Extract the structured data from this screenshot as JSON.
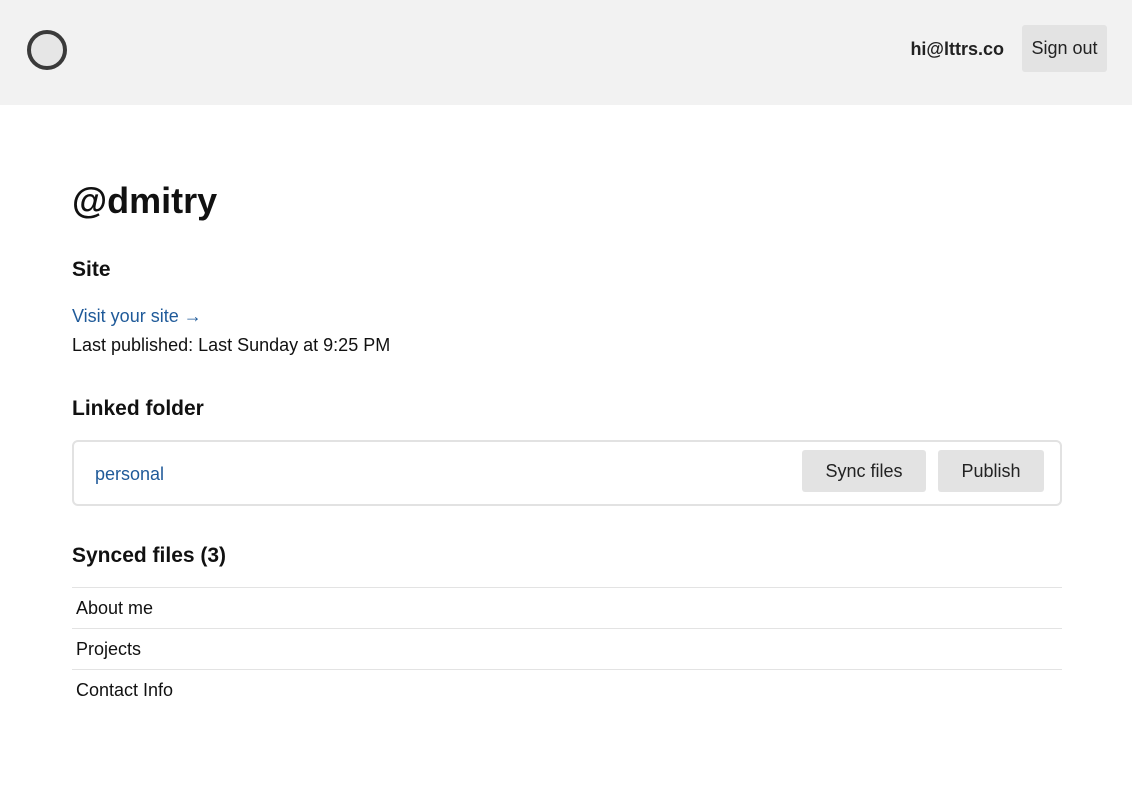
{
  "header": {
    "logo_icon": "circle-logo-icon",
    "email": "hi@lttrs.co",
    "signout_label": "Sign out"
  },
  "profile": {
    "handle": "@dmitry"
  },
  "site": {
    "heading": "Site",
    "visit_link": "Visit your site →",
    "last_published": "Last published: Last Sunday at 9:25 PM"
  },
  "linked_folder": {
    "heading": "Linked folder",
    "folder_name": "personal",
    "sync_label": "Sync files",
    "publish_label": "Publish"
  },
  "synced_files": {
    "heading": "Synced files (3)",
    "files": [
      "About me",
      "Projects",
      "Contact Info"
    ]
  }
}
